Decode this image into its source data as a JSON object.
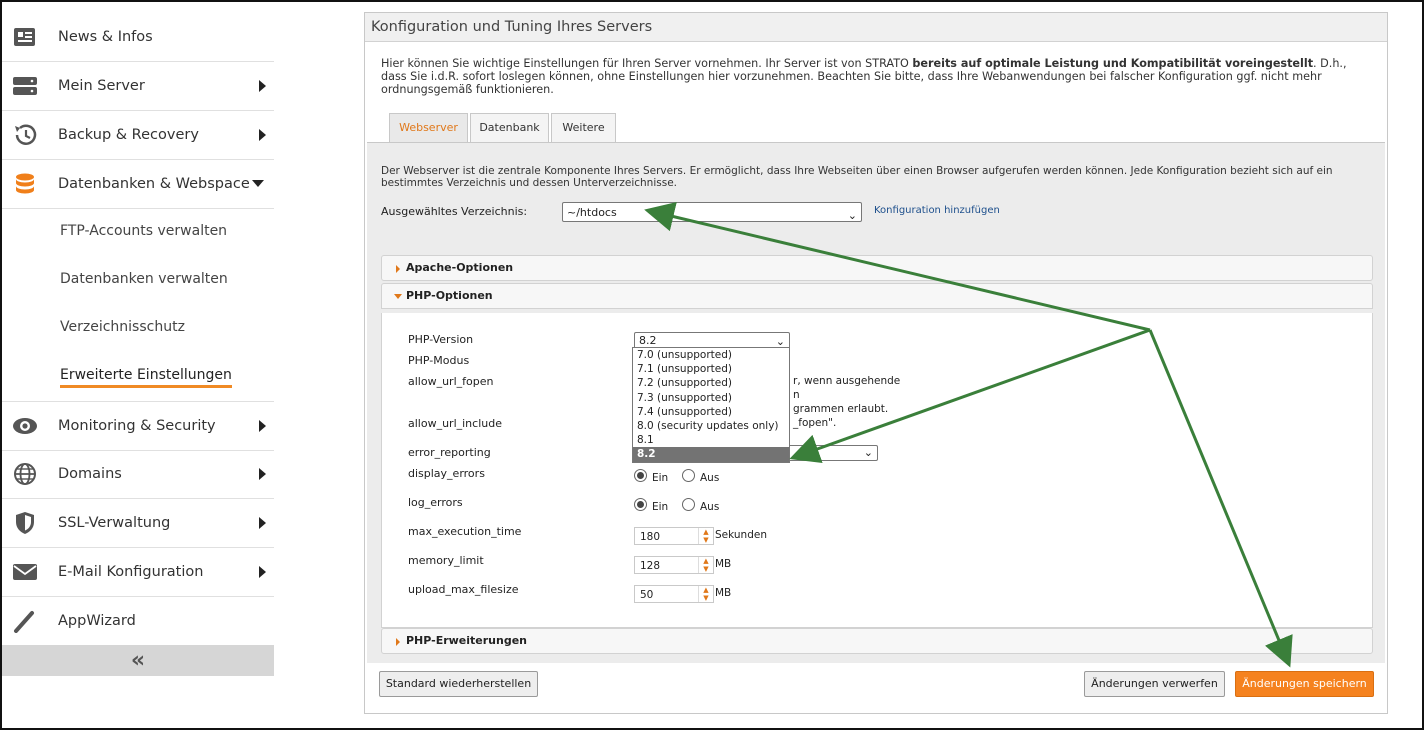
{
  "sidebar": {
    "items": [
      {
        "label": "News & Infos",
        "icon": "news-icon"
      },
      {
        "label": "Mein Server",
        "icon": "server-icon"
      },
      {
        "label": "Backup & Recovery",
        "icon": "history-icon"
      },
      {
        "label": "Datenbanken & Webspace",
        "icon": "database-icon"
      },
      {
        "label": "Monitoring & Security",
        "icon": "eye-icon"
      },
      {
        "label": "Domains",
        "icon": "globe-icon"
      },
      {
        "label": "SSL-Verwaltung",
        "icon": "shield-icon"
      },
      {
        "label": "E-Mail Konfiguration",
        "icon": "envelope-icon"
      },
      {
        "label": "AppWizard",
        "icon": "wand-icon"
      }
    ],
    "subitems": [
      "FTP-Accounts verwalten",
      "Datenbanken verwalten",
      "Verzeichnisschutz",
      "Erweiterte Einstellungen"
    ],
    "collapse_label": "«"
  },
  "panel": {
    "title": "Konfiguration und Tuning Ihres Servers",
    "intro_a": "Hier können Sie wichtige Einstellungen für Ihren Server vornehmen. Ihr Server ist von STRATO ",
    "intro_bold": "bereits auf optimale Leistung und Kompatibilität voreingestellt",
    "intro_b": ". D.h., dass Sie i.d.R. sofort loslegen können, ohne Einstellungen hier vorzunehmen. Beachten Sie bitte, dass Ihre Webanwendungen bei falscher Konfiguration ggf. nicht mehr ordnungsgemäß funktionieren.",
    "tabs": [
      "Webserver",
      "Datenbank",
      "Weitere"
    ],
    "description": "Der Webserver ist die zentrale Komponente Ihres Servers. Er ermöglicht, dass Ihre Webseiten über einen Browser aufgerufen werden können. Jede Konfiguration bezieht sich auf ein bestimmtes Verzeichnis und dessen Unterverzeichnisse.",
    "directory_label": "Ausgewähltes Verzeichnis:",
    "directory_value": "~/htdocs",
    "add_config_link": "Konfiguration hinzufügen",
    "accordions": [
      "Apache-Optionen",
      "PHP-Optionen",
      "PHP-Erweiterungen"
    ]
  },
  "php": {
    "labels": [
      "PHP-Version",
      "PHP-Modus",
      "allow_url_fopen",
      "allow_url_include",
      "error_reporting",
      "display_errors",
      "log_errors",
      "max_execution_time",
      "memory_limit",
      "upload_max_filesize"
    ],
    "version_value": "8.2",
    "version_options": [
      "7.0 (unsupported)",
      "7.1 (unsupported)",
      "7.2 (unsupported)",
      "7.3 (unsupported)",
      "7.4 (unsupported)",
      "8.0 (security updates only)",
      "8.1",
      "8.2"
    ],
    "frag1": "r, wenn ausgehende",
    "frag2": "n",
    "frag3": "grammen erlaubt.",
    "frag4": "_fopen\".",
    "radio_on": "Ein",
    "radio_off": "Aus",
    "max_execution_time": "180",
    "max_execution_time_unit": "Sekunden",
    "memory_limit": "128",
    "memory_limit_unit": "MB",
    "upload_max_filesize": "50",
    "upload_max_filesize_unit": "MB"
  },
  "buttons": {
    "reset": "Standard wiederherstellen",
    "discard": "Änderungen verwerfen",
    "save": "Änderungen speichern"
  },
  "colors": {
    "accent": "#f5821f",
    "annotation_arrow": "#3a7f3a"
  }
}
